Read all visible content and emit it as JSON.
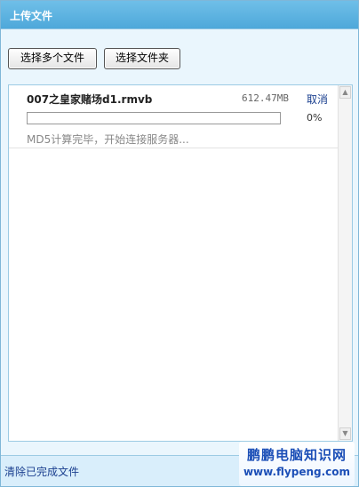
{
  "window": {
    "title": "上传文件"
  },
  "toolbar": {
    "select_files_label": "选择多个文件",
    "select_folder_label": "选择文件夹"
  },
  "upload_list": {
    "items": [
      {
        "name": "007之皇家赌场d1.rmvb",
        "size": "612.47MB",
        "cancel_label": "取消",
        "progress_percent": 0,
        "progress_text": "0%",
        "status": "MD5计算完毕，开始连接服务器..."
      }
    ]
  },
  "footer": {
    "clear_completed_label": "清除已完成文件"
  },
  "watermark": {
    "name": "鹏鹏电脑知识网",
    "url": "www.flypeng.com"
  },
  "icons": {
    "scroll_up": "scroll-up-arrow-icon",
    "scroll_down": "scroll-down-arrow-icon"
  },
  "colors": {
    "title_bar": "#4ea8da",
    "accent": "#1a3f8f",
    "panel_bg": "#eaf6fd"
  }
}
